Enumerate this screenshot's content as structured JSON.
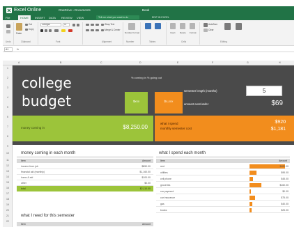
{
  "app": {
    "title": "Excel Online",
    "crumb": "OneDrive › Documents",
    "doc": "Book"
  },
  "tabs": [
    "File",
    "HOME",
    "INSERT",
    "DATA",
    "REVIEW",
    "VIEW"
  ],
  "tell_me": "Tell me what you want to do",
  "edit_in": "EDIT IN EXCEL",
  "ribbon": {
    "font_name": "Georgia",
    "font_size": "11",
    "paste": "Paste",
    "cut": "Cut",
    "copy": "Copy",
    "wrap": "Wrap Text",
    "merge": "Merge & Center",
    "number_format": "Number Format",
    "conditional": "Conditional Formatting",
    "format_as_table": "Format as Table",
    "insert": "Insert",
    "delete": "Delete",
    "format": "Format",
    "autosum": "AutoSum",
    "sort_filter": "Sort & Filter",
    "find": "Find",
    "clear": "Clear",
    "groups": {
      "undo": "Undo",
      "clipboard": "Clipboard",
      "font": "Font",
      "alignment": "Alignment",
      "number": "Number",
      "tables": "Tables",
      "cells": "Cells",
      "editing": "Editing"
    }
  },
  "formula_bar": {
    "name_box": "A1",
    "fx": "fx"
  },
  "columns": [
    "A",
    "B",
    "C",
    "D",
    "E",
    "F",
    "G",
    "H"
  ],
  "rows": [
    "1",
    "2",
    "3",
    "4",
    "5",
    "6",
    "7",
    "8",
    "9",
    "10",
    "11",
    "12",
    "13",
    "14",
    "15",
    "16",
    "17",
    "18",
    "19",
    "20",
    "21",
    "22",
    "23"
  ],
  "budget": {
    "title_line1": "college",
    "title_line2": "budget",
    "legend": "% coming in   % going out",
    "box_green": "$xxx",
    "box_orange": "$x,xxx",
    "semester_label": "semester length (months)",
    "semester_value": "5",
    "amount_left_label": "amount over/under",
    "amount_left_value": "$69",
    "coming_in_label": "money coming in",
    "coming_in_value": "$8,250.00",
    "spend_label": "what I spend",
    "spend_value": "$920",
    "monthly_label": "monthly semester cost",
    "monthly_value": "$1,181"
  },
  "left_table": {
    "title": "money coming in each month",
    "headers": [
      "Item",
      "Amount"
    ],
    "rows": [
      {
        "item": "income from job",
        "amount": "$850.00"
      },
      {
        "item": "financial aid (monthly)",
        "amount": "$1,160.00"
      },
      {
        "item": "loans & aid",
        "amount": "$100.00"
      },
      {
        "item": "other",
        "amount": "$0.00"
      },
      {
        "item": "total",
        "amount": "$2,110.00"
      }
    ]
  },
  "right_table": {
    "title": "what I spend each month",
    "headers": [
      "Item",
      "Amount"
    ],
    "rows": [
      {
        "item": "rent",
        "amount": "$480.00",
        "share": 0.52
      },
      {
        "item": "utilities",
        "amount": "$95.00",
        "share": 0.1
      },
      {
        "item": "cell phone",
        "amount": "$45.00",
        "share": 0.05
      },
      {
        "item": "groceries",
        "amount": "$160.00",
        "share": 0.17
      },
      {
        "item": "car payment",
        "amount": "$0.00",
        "share": 0.0
      },
      {
        "item": "car insurance",
        "amount": "$75.00",
        "share": 0.08
      },
      {
        "item": "gas",
        "amount": "$40.00",
        "share": 0.04
      },
      {
        "item": "books",
        "amount": "$25.00",
        "share": 0.03
      }
    ]
  },
  "bottom_table": {
    "title": "what I need for this semester",
    "headers": [
      "Item",
      "Amount"
    ]
  },
  "colors": {
    "excel_green": "#217346",
    "dark_panel": "#4a4a4a",
    "lime": "#9cc43a",
    "orange": "#f28d1d"
  }
}
